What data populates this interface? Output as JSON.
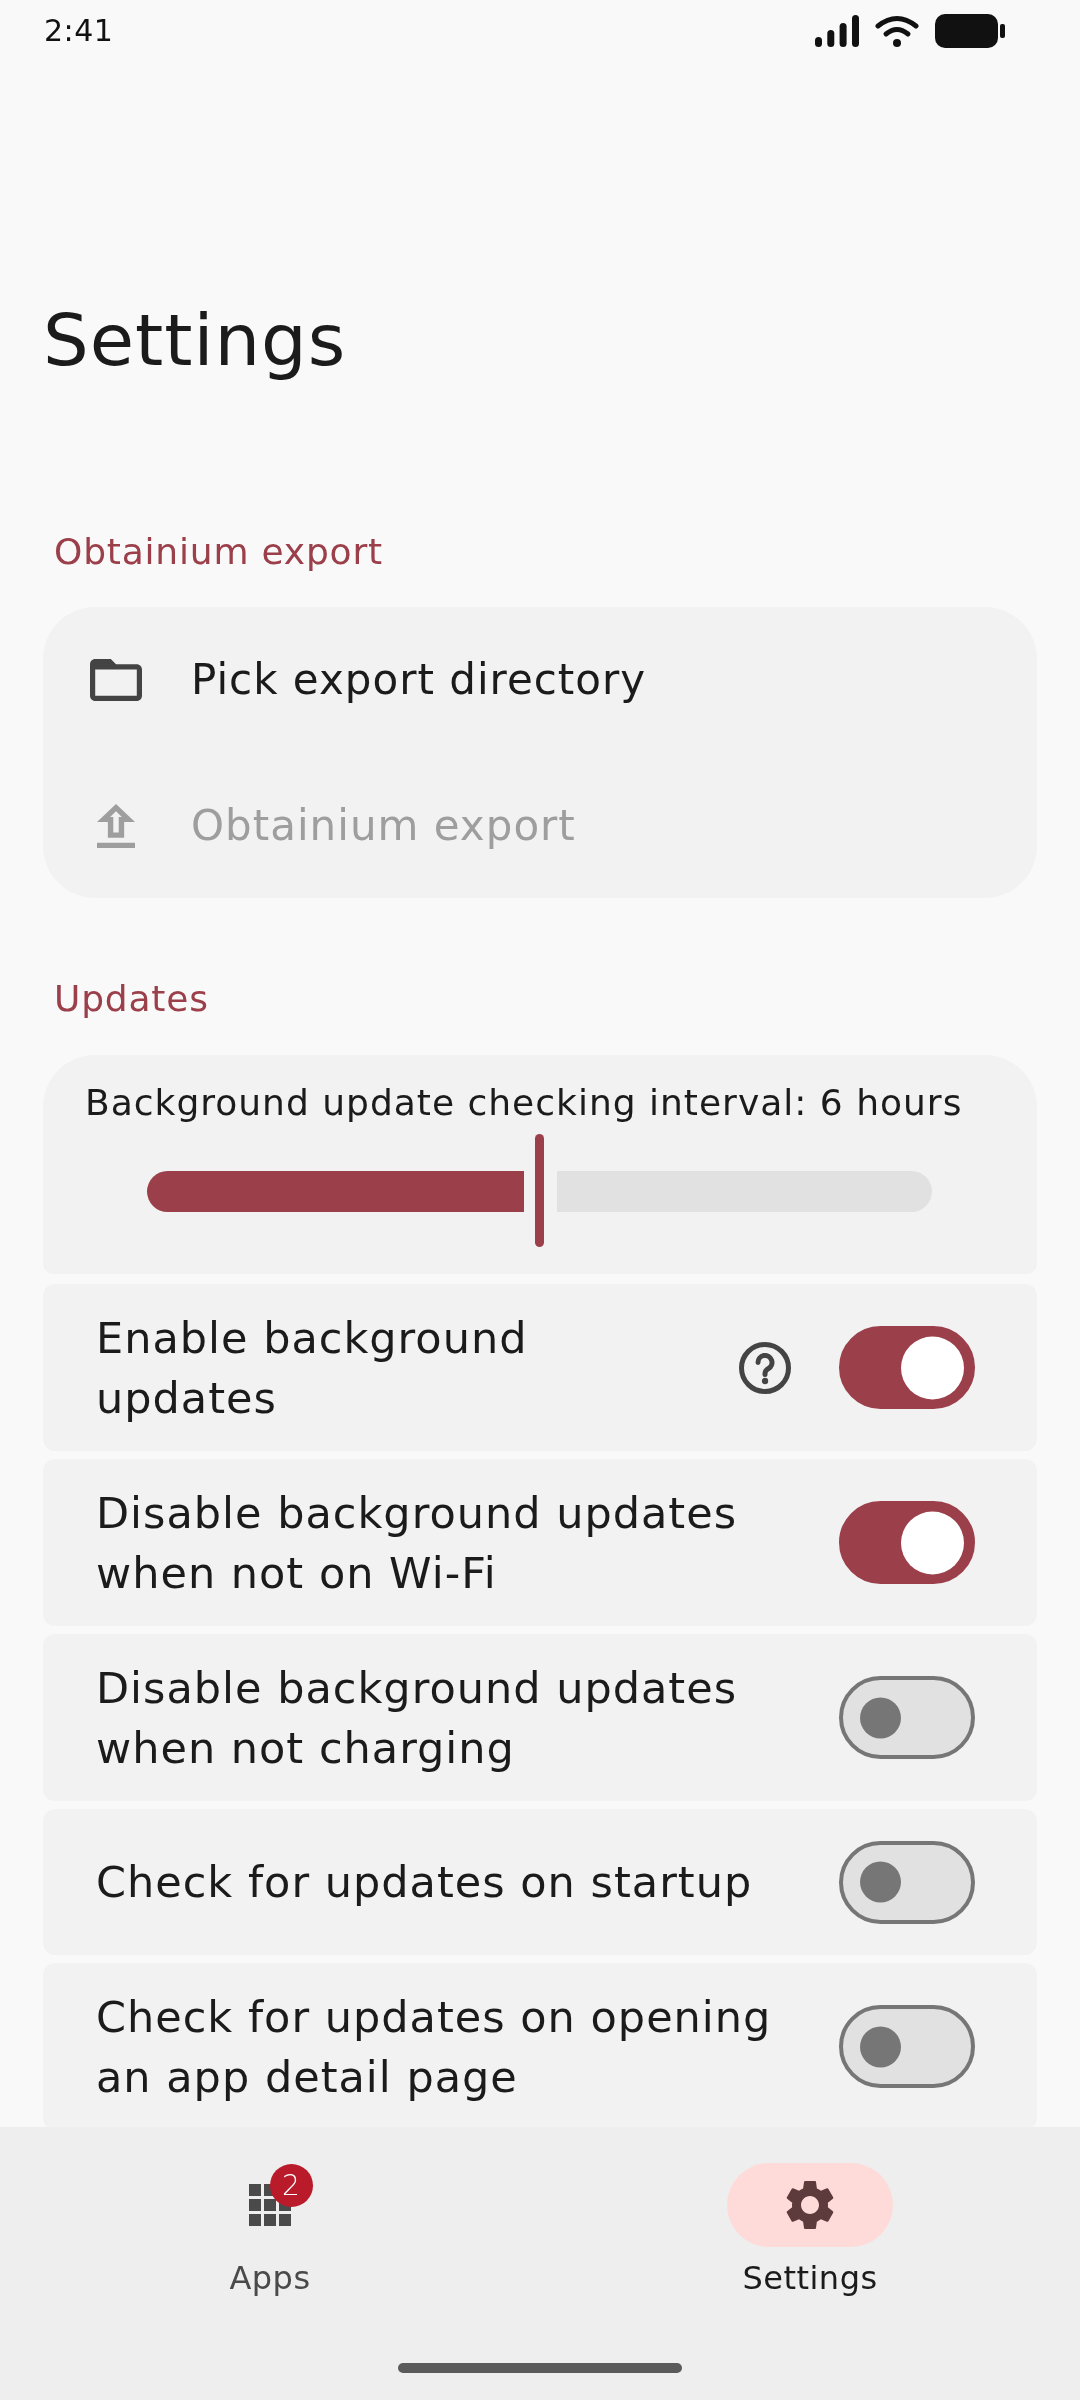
{
  "status_bar": {
    "time": "2:41"
  },
  "page_title": "Settings",
  "export_section": {
    "header": "Obtainium export",
    "items": [
      {
        "label": "Pick export directory",
        "disabled": false
      },
      {
        "label": "Obtainium export",
        "disabled": true
      }
    ]
  },
  "updates_section": {
    "header": "Updates",
    "interval_slider": {
      "label": "Background update checking interval: 6 hours",
      "level": 0.5
    },
    "toggles": [
      {
        "label": "Enable background updates",
        "on": true,
        "help": true
      },
      {
        "label": "Disable background updates when not on Wi-Fi",
        "on": true,
        "help": false
      },
      {
        "label": "Disable background updates when not charging",
        "on": false,
        "help": false
      },
      {
        "label": "Check for updates on startup",
        "on": false,
        "help": false
      },
      {
        "label": "Check for updates on opening an app detail page",
        "on": false,
        "help": false
      }
    ]
  },
  "bottom_nav": [
    {
      "label": "Apps",
      "selected": false,
      "badge": "2"
    },
    {
      "label": "Settings",
      "selected": true
    }
  ]
}
